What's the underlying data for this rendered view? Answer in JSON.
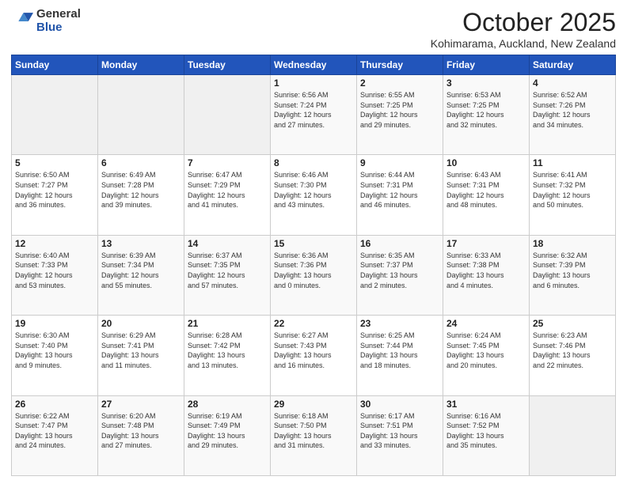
{
  "logo": {
    "general": "General",
    "blue": "Blue"
  },
  "header": {
    "month": "October 2025",
    "location": "Kohimarama, Auckland, New Zealand"
  },
  "weekdays": [
    "Sunday",
    "Monday",
    "Tuesday",
    "Wednesday",
    "Thursday",
    "Friday",
    "Saturday"
  ],
  "weeks": [
    [
      {
        "day": "",
        "info": ""
      },
      {
        "day": "",
        "info": ""
      },
      {
        "day": "",
        "info": ""
      },
      {
        "day": "1",
        "info": "Sunrise: 6:56 AM\nSunset: 7:24 PM\nDaylight: 12 hours\nand 27 minutes."
      },
      {
        "day": "2",
        "info": "Sunrise: 6:55 AM\nSunset: 7:25 PM\nDaylight: 12 hours\nand 29 minutes."
      },
      {
        "day": "3",
        "info": "Sunrise: 6:53 AM\nSunset: 7:25 PM\nDaylight: 12 hours\nand 32 minutes."
      },
      {
        "day": "4",
        "info": "Sunrise: 6:52 AM\nSunset: 7:26 PM\nDaylight: 12 hours\nand 34 minutes."
      }
    ],
    [
      {
        "day": "5",
        "info": "Sunrise: 6:50 AM\nSunset: 7:27 PM\nDaylight: 12 hours\nand 36 minutes."
      },
      {
        "day": "6",
        "info": "Sunrise: 6:49 AM\nSunset: 7:28 PM\nDaylight: 12 hours\nand 39 minutes."
      },
      {
        "day": "7",
        "info": "Sunrise: 6:47 AM\nSunset: 7:29 PM\nDaylight: 12 hours\nand 41 minutes."
      },
      {
        "day": "8",
        "info": "Sunrise: 6:46 AM\nSunset: 7:30 PM\nDaylight: 12 hours\nand 43 minutes."
      },
      {
        "day": "9",
        "info": "Sunrise: 6:44 AM\nSunset: 7:31 PM\nDaylight: 12 hours\nand 46 minutes."
      },
      {
        "day": "10",
        "info": "Sunrise: 6:43 AM\nSunset: 7:31 PM\nDaylight: 12 hours\nand 48 minutes."
      },
      {
        "day": "11",
        "info": "Sunrise: 6:41 AM\nSunset: 7:32 PM\nDaylight: 12 hours\nand 50 minutes."
      }
    ],
    [
      {
        "day": "12",
        "info": "Sunrise: 6:40 AM\nSunset: 7:33 PM\nDaylight: 12 hours\nand 53 minutes."
      },
      {
        "day": "13",
        "info": "Sunrise: 6:39 AM\nSunset: 7:34 PM\nDaylight: 12 hours\nand 55 minutes."
      },
      {
        "day": "14",
        "info": "Sunrise: 6:37 AM\nSunset: 7:35 PM\nDaylight: 12 hours\nand 57 minutes."
      },
      {
        "day": "15",
        "info": "Sunrise: 6:36 AM\nSunset: 7:36 PM\nDaylight: 13 hours\nand 0 minutes."
      },
      {
        "day": "16",
        "info": "Sunrise: 6:35 AM\nSunset: 7:37 PM\nDaylight: 13 hours\nand 2 minutes."
      },
      {
        "day": "17",
        "info": "Sunrise: 6:33 AM\nSunset: 7:38 PM\nDaylight: 13 hours\nand 4 minutes."
      },
      {
        "day": "18",
        "info": "Sunrise: 6:32 AM\nSunset: 7:39 PM\nDaylight: 13 hours\nand 6 minutes."
      }
    ],
    [
      {
        "day": "19",
        "info": "Sunrise: 6:30 AM\nSunset: 7:40 PM\nDaylight: 13 hours\nand 9 minutes."
      },
      {
        "day": "20",
        "info": "Sunrise: 6:29 AM\nSunset: 7:41 PM\nDaylight: 13 hours\nand 11 minutes."
      },
      {
        "day": "21",
        "info": "Sunrise: 6:28 AM\nSunset: 7:42 PM\nDaylight: 13 hours\nand 13 minutes."
      },
      {
        "day": "22",
        "info": "Sunrise: 6:27 AM\nSunset: 7:43 PM\nDaylight: 13 hours\nand 16 minutes."
      },
      {
        "day": "23",
        "info": "Sunrise: 6:25 AM\nSunset: 7:44 PM\nDaylight: 13 hours\nand 18 minutes."
      },
      {
        "day": "24",
        "info": "Sunrise: 6:24 AM\nSunset: 7:45 PM\nDaylight: 13 hours\nand 20 minutes."
      },
      {
        "day": "25",
        "info": "Sunrise: 6:23 AM\nSunset: 7:46 PM\nDaylight: 13 hours\nand 22 minutes."
      }
    ],
    [
      {
        "day": "26",
        "info": "Sunrise: 6:22 AM\nSunset: 7:47 PM\nDaylight: 13 hours\nand 24 minutes."
      },
      {
        "day": "27",
        "info": "Sunrise: 6:20 AM\nSunset: 7:48 PM\nDaylight: 13 hours\nand 27 minutes."
      },
      {
        "day": "28",
        "info": "Sunrise: 6:19 AM\nSunset: 7:49 PM\nDaylight: 13 hours\nand 29 minutes."
      },
      {
        "day": "29",
        "info": "Sunrise: 6:18 AM\nSunset: 7:50 PM\nDaylight: 13 hours\nand 31 minutes."
      },
      {
        "day": "30",
        "info": "Sunrise: 6:17 AM\nSunset: 7:51 PM\nDaylight: 13 hours\nand 33 minutes."
      },
      {
        "day": "31",
        "info": "Sunrise: 6:16 AM\nSunset: 7:52 PM\nDaylight: 13 hours\nand 35 minutes."
      },
      {
        "day": "",
        "info": ""
      }
    ]
  ]
}
